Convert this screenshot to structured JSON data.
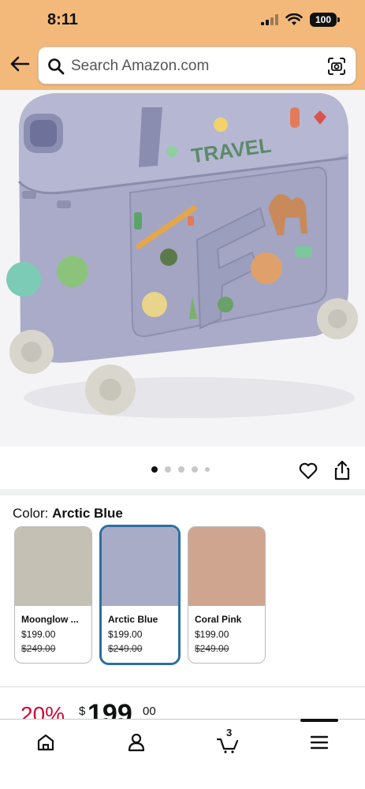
{
  "status_bar": {
    "time": "8:11",
    "battery": "100"
  },
  "header": {
    "search_placeholder": "Search Amazon.com"
  },
  "product": {
    "sticker_text": "TRAVEL"
  },
  "color_selector": {
    "label": "Color:",
    "selected": "Arctic Blue",
    "options": [
      {
        "name": "Moonglow ...",
        "price": "$199.00",
        "list_price": "$249.00",
        "color": "#c5c0b4"
      },
      {
        "name": "Arctic Blue",
        "price": "$199.00",
        "list_price": "$249.00",
        "color": "#a9acc6"
      },
      {
        "name": "Coral Pink",
        "price": "$199.00",
        "list_price": "$249.00",
        "color": "#d0a590"
      }
    ]
  },
  "pricing": {
    "discount": "20%",
    "currency": "$",
    "whole": "199",
    "fraction": "00"
  },
  "bottom_nav": {
    "cart_count": "3"
  }
}
